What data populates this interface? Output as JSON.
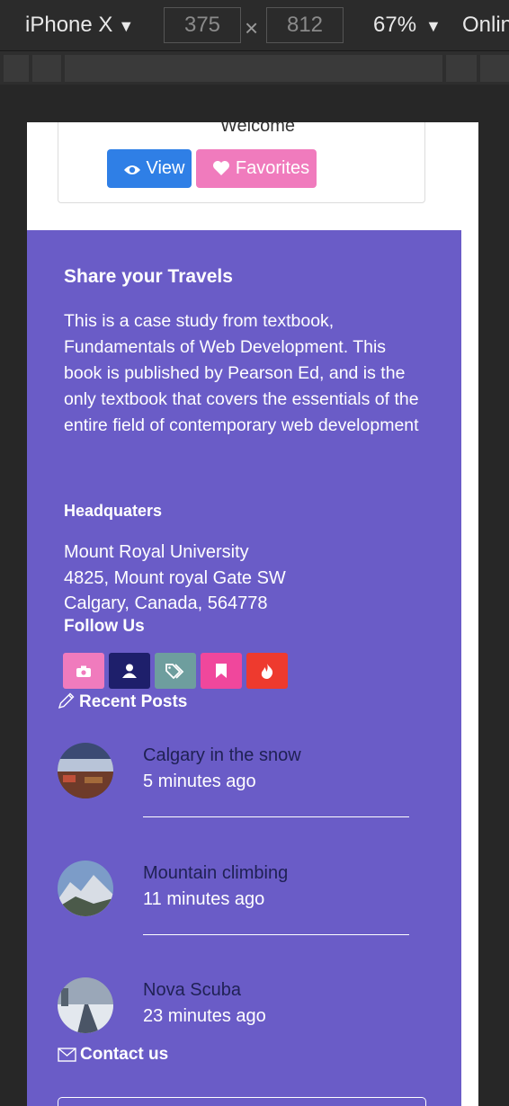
{
  "devtools": {
    "device": "iPhone X",
    "width": "375",
    "height": "812",
    "times": "×",
    "zoom": "67%",
    "network": "Onlin"
  },
  "card": {
    "title": "Welcome",
    "view_label": "View",
    "favorites_label": "Favorites",
    "view_color": "#2f7fe6",
    "favorites_color": "#f07bbd"
  },
  "footer": {
    "bg_color": "#6a5cc7",
    "title": "Share your Travels",
    "description": "This is a case study from textbook, Fundamentals of Web Development. This book is published by Pearson Ed, and is the only textbook that covers the essentials of the entire field of contemporary web development",
    "hq_heading": "Headquaters",
    "address": [
      "Mount Royal University",
      "4825, Mount royal Gate SW",
      "Calgary, Canada, 564778"
    ],
    "follow_heading": "Follow Us",
    "social": [
      {
        "icon": "camera-icon",
        "color": "#f07bbd"
      },
      {
        "icon": "user-icon",
        "color": "#1e1f6b"
      },
      {
        "icon": "tags-icon",
        "color": "#6e9e9e"
      },
      {
        "icon": "bookmark-icon",
        "color": "#f0479c"
      },
      {
        "icon": "fire-icon",
        "color": "#ee3a2e"
      }
    ],
    "recent_heading": "Recent Posts",
    "posts": [
      {
        "title": "Calgary in the snow",
        "time": "5 minutes ago"
      },
      {
        "title": "Mountain climbing",
        "time": "11 minutes ago"
      },
      {
        "title": "Nova Scuba",
        "time": "23 minutes ago"
      }
    ],
    "contact_heading": "Contact us"
  }
}
